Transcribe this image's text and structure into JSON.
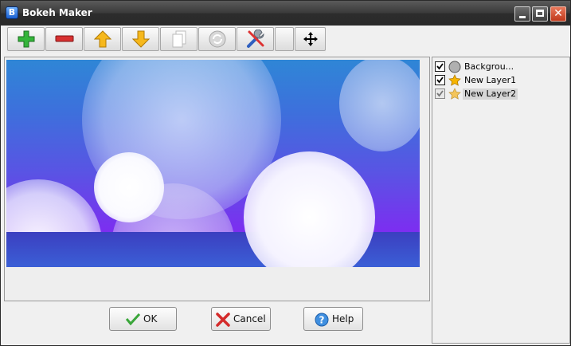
{
  "window": {
    "title": "Bokeh Maker"
  },
  "toolbar": {
    "buttons": [
      {
        "icon": "add-icon"
      },
      {
        "icon": "remove-icon"
      },
      {
        "icon": "move-up-icon"
      },
      {
        "icon": "move-down-icon"
      },
      {
        "icon": "duplicate-icon"
      },
      {
        "icon": "refresh-icon"
      },
      {
        "icon": "tools-icon"
      },
      {
        "icon": "blank"
      },
      {
        "icon": "move-icon"
      }
    ]
  },
  "layers": [
    {
      "label": "Backgrou...",
      "checked": true,
      "icon": "circle-icon",
      "selected": false
    },
    {
      "label": "New Layer1",
      "checked": true,
      "icon": "star-icon",
      "selected": false
    },
    {
      "label": "New Layer2",
      "checked": true,
      "icon": "star-icon",
      "selected": true
    }
  ],
  "dialog": {
    "ok_label": "OK",
    "cancel_label": "Cancel",
    "help_label": "Help"
  },
  "colors": {
    "titlebar": "#3a3a3a",
    "close_button": "#d9532f",
    "accent_green": "#2fae2f"
  }
}
